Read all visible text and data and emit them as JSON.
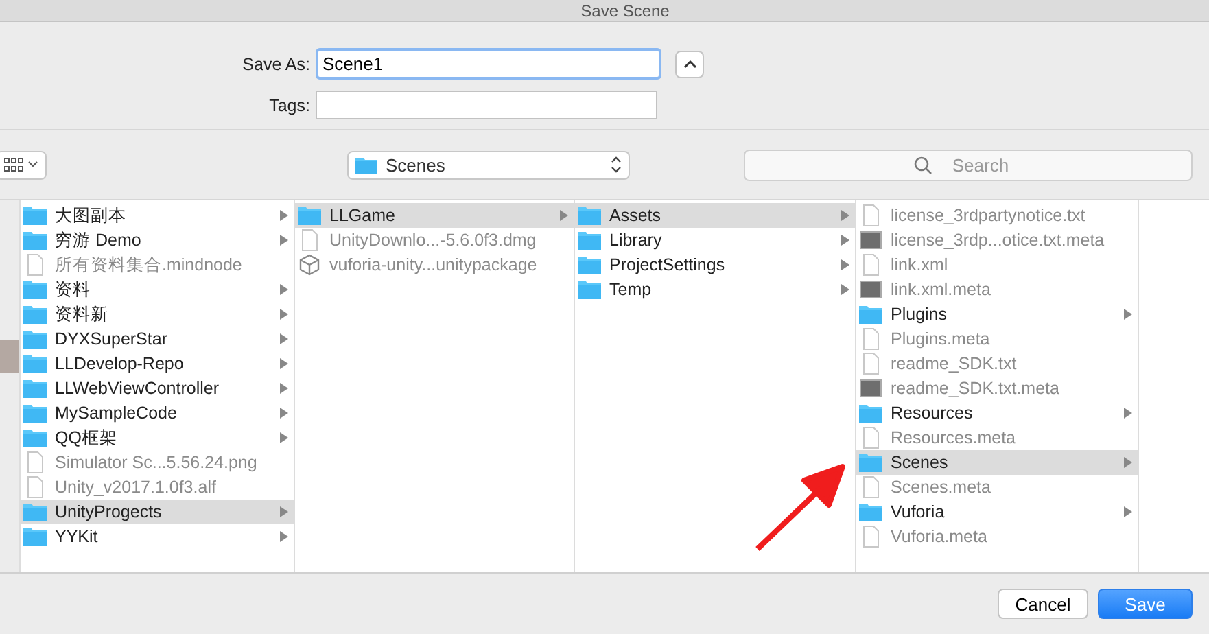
{
  "window": {
    "title": "Save Scene"
  },
  "save_as": {
    "label": "Save As:",
    "value": "Scene1"
  },
  "tags": {
    "label": "Tags:"
  },
  "location": {
    "label": "Scenes"
  },
  "search": {
    "placeholder": "Search"
  },
  "columns": [
    {
      "items": [
        {
          "name": "大图副本",
          "kind": "folder",
          "selected": false
        },
        {
          "name": "穷游 Demo",
          "kind": "folder",
          "selected": false
        },
        {
          "name": "所有资料集合.mindnode",
          "kind": "document",
          "selected": false
        },
        {
          "name": "资料",
          "kind": "folder",
          "selected": false
        },
        {
          "name": "资料新",
          "kind": "folder",
          "selected": false
        },
        {
          "name": "DYXSuperStar",
          "kind": "folder",
          "selected": false
        },
        {
          "name": "LLDevelop-Repo",
          "kind": "folder",
          "selected": false
        },
        {
          "name": "LLWebViewController",
          "kind": "folder",
          "selected": false
        },
        {
          "name": "MySampleCode",
          "kind": "folder",
          "selected": false
        },
        {
          "name": "QQ框架",
          "kind": "folder",
          "selected": false
        },
        {
          "name": "Simulator Sc...5.56.24.png",
          "kind": "document",
          "selected": false
        },
        {
          "name": "Unity_v2017.1.0f3.alf",
          "kind": "document",
          "selected": false
        },
        {
          "name": "UnityProgects",
          "kind": "folder",
          "selected": true
        },
        {
          "name": "YYKit",
          "kind": "folder",
          "selected": false
        }
      ]
    },
    {
      "items": [
        {
          "name": "LLGame",
          "kind": "folder",
          "selected": true
        },
        {
          "name": "UnityDownlo...-5.6.0f3.dmg",
          "kind": "document",
          "selected": false
        },
        {
          "name": "vuforia-unity...unitypackage",
          "kind": "package",
          "selected": false
        }
      ]
    },
    {
      "items": [
        {
          "name": "Assets",
          "kind": "folder",
          "selected": true
        },
        {
          "name": "Library",
          "kind": "folder",
          "selected": false
        },
        {
          "name": "ProjectSettings",
          "kind": "folder",
          "selected": false
        },
        {
          "name": "Temp",
          "kind": "folder",
          "selected": false
        }
      ]
    },
    {
      "items": [
        {
          "name": "license_3rdpartynotice.txt",
          "kind": "document",
          "selected": false
        },
        {
          "name": "license_3rdp...otice.txt.meta",
          "kind": "meta",
          "selected": false
        },
        {
          "name": "link.xml",
          "kind": "document",
          "selected": false
        },
        {
          "name": "link.xml.meta",
          "kind": "meta",
          "selected": false
        },
        {
          "name": "Plugins",
          "kind": "folder",
          "selected": false
        },
        {
          "name": "Plugins.meta",
          "kind": "document",
          "selected": false
        },
        {
          "name": "readme_SDK.txt",
          "kind": "document",
          "selected": false
        },
        {
          "name": "readme_SDK.txt.meta",
          "kind": "meta",
          "selected": false
        },
        {
          "name": "Resources",
          "kind": "folder",
          "selected": false
        },
        {
          "name": "Resources.meta",
          "kind": "document",
          "selected": false
        },
        {
          "name": "Scenes",
          "kind": "folder",
          "selected": true
        },
        {
          "name": "Scenes.meta",
          "kind": "document",
          "selected": false
        },
        {
          "name": "Vuforia",
          "kind": "folder",
          "selected": false
        },
        {
          "name": "Vuforia.meta",
          "kind": "document",
          "selected": false
        }
      ]
    }
  ],
  "buttons": [
    {
      "label": "Cancel",
      "kind": "secondary"
    },
    {
      "label": "Save",
      "kind": "primary"
    }
  ]
}
